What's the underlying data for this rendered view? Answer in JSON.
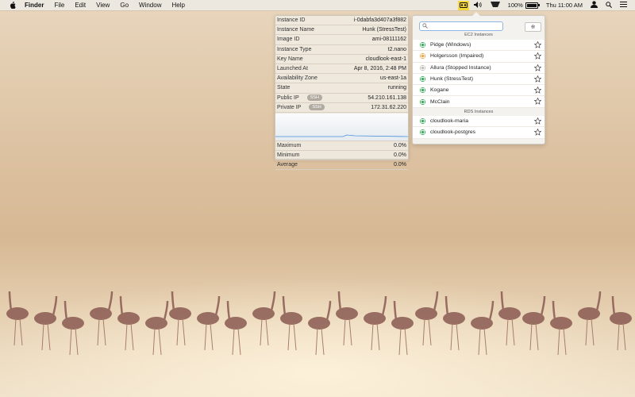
{
  "menubar": {
    "app": "Finder",
    "menus": [
      "File",
      "Edit",
      "View",
      "Go",
      "Window",
      "Help"
    ],
    "battery_percent": "100%",
    "battery_level": 1.0,
    "clock": "Thu 11:00 AM"
  },
  "detail": {
    "rows": [
      {
        "key": "Instance ID",
        "value": "i-0dabfa3d407a3f882"
      },
      {
        "key": "Instance Name",
        "value": "Hunk (StressTest)"
      },
      {
        "key": "Image ID",
        "value": "ami-08111162"
      },
      {
        "key": "Instance Type",
        "value": "t2.nano"
      },
      {
        "key": "Key Name",
        "value": "cloudlook-east-1"
      },
      {
        "key": "Launched At",
        "value": "Apr 8, 2016, 2:48 PM"
      },
      {
        "key": "Availability Zone",
        "value": "us-east-1a"
      },
      {
        "key": "State",
        "value": "running"
      },
      {
        "key": "Public IP",
        "value": "54.210.161.138",
        "badge": "SSH"
      },
      {
        "key": "Private IP",
        "value": "172.31.62.220",
        "badge": "SSH"
      }
    ],
    "stats": [
      {
        "key": "Maximum",
        "value": "0.0%"
      },
      {
        "key": "Minimum",
        "value": "0.0%"
      },
      {
        "key": "Average",
        "value": "0.0%"
      }
    ]
  },
  "popover": {
    "search_placeholder": "",
    "ec2_header": "EC2 Instances",
    "ec2": [
      {
        "name": "Pidge (Windows)",
        "color": "#3daa5c"
      },
      {
        "name": "Holgersson (Impaired)",
        "color": "#e9a84a"
      },
      {
        "name": "Allura (Stopped Instance)",
        "color": "#c0bdb8"
      },
      {
        "name": "Hunk (StressTest)",
        "color": "#3daa5c"
      },
      {
        "name": "Kogane",
        "color": "#3daa5c"
      },
      {
        "name": "McClain",
        "color": "#3daa5c"
      }
    ],
    "rds_header": "RDS Instances",
    "rds": [
      {
        "name": "cloudlook-maria",
        "color": "#3daa5c"
      },
      {
        "name": "cloudlook-postgres",
        "color": "#3daa5c"
      }
    ]
  },
  "colors": {
    "accent": "#8db6e6",
    "running": "#3daa5c",
    "impaired": "#e9a84a",
    "stopped": "#c0bdb8"
  },
  "icons": {
    "apple": "apple-icon",
    "cloud": "cloudlook-icon",
    "volume": "volume-icon",
    "wifi": "wifi-icon",
    "user": "user-icon",
    "search": "search-icon",
    "menu": "list-icon",
    "gear": "gear-icon",
    "star": "star-icon"
  }
}
